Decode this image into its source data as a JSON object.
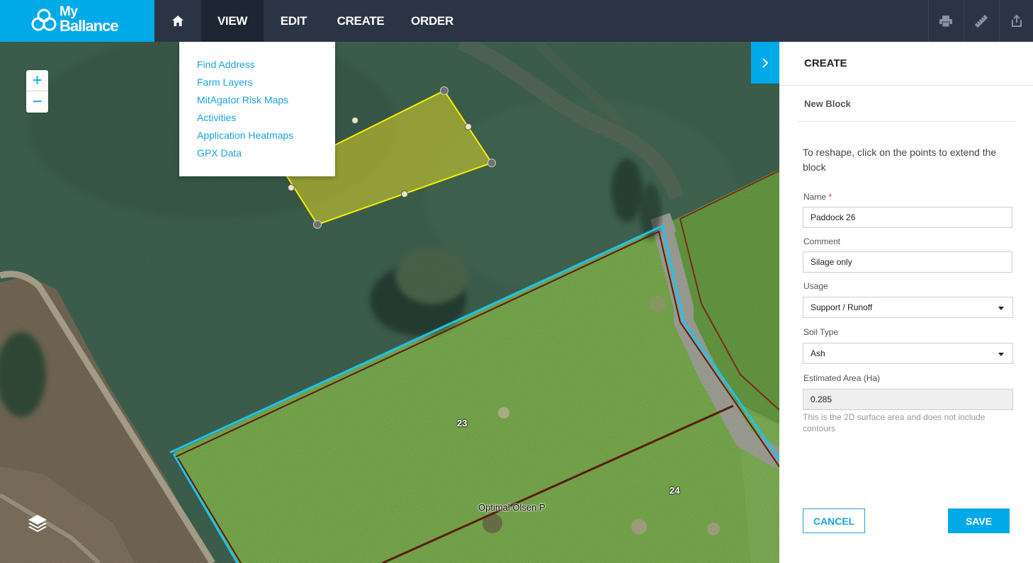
{
  "brand": {
    "line1": "My",
    "line2": "Ballance",
    "accent": "#00a9e7"
  },
  "nav": {
    "home_icon": "home-icon",
    "view": "VIEW",
    "edit": "EDIT",
    "create": "CREATE",
    "order": "ORDER"
  },
  "toolbar": {
    "icons": [
      "print-icon",
      "ruler-icon",
      "share-icon"
    ]
  },
  "view_menu": {
    "items": [
      "Find Address",
      "Farm Layers",
      "MitAgator Risk Maps",
      "Activities",
      "Application Heatmaps",
      "GPX Data"
    ]
  },
  "map": {
    "zoom_in": "+",
    "zoom_out": "−",
    "labels": {
      "paddock_23": "23",
      "paddock_24": "24",
      "farm_name": "Optimal Olsen P"
    },
    "layers_icon": "layers-icon"
  },
  "panel": {
    "title": "CREATE",
    "subtitle": "New Block",
    "instructions": "To reshape, click on the points to extend the block",
    "fields": {
      "name": {
        "label": "Name",
        "required_mark": "*",
        "value": "Paddock 26"
      },
      "comment": {
        "label": "Comment",
        "value": "Silage only"
      },
      "usage": {
        "label": "Usage",
        "value": "Support / Runoff"
      },
      "soil_type": {
        "label": "Soil Type",
        "value": "Ash"
      },
      "area": {
        "label": "Estimated Area (Ha)",
        "value": "0.285"
      }
    },
    "area_note": "This is the 2D surface area and does not include contours",
    "cancel_label": "CANCEL",
    "save_label": "SAVE"
  }
}
